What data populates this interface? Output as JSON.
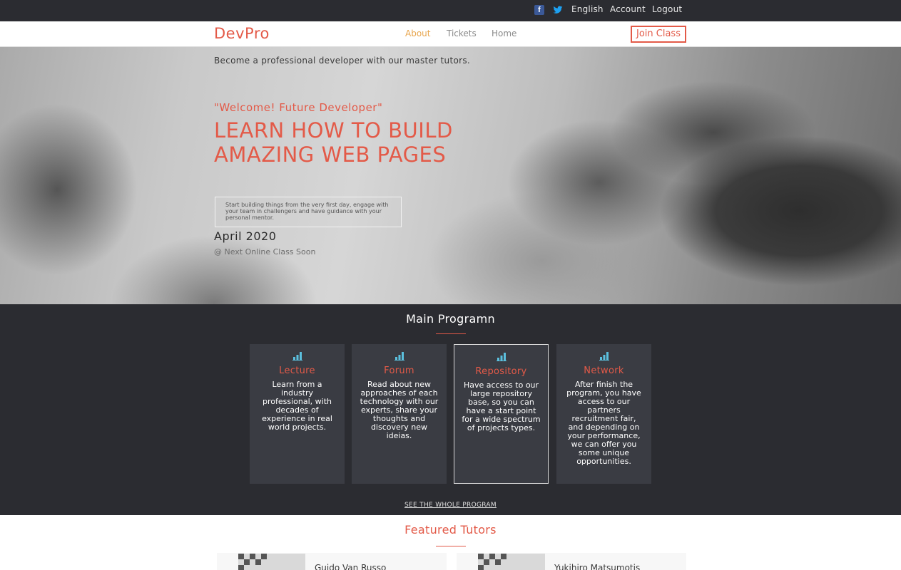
{
  "topbar": {
    "social": [
      {
        "icon": "facebook-icon",
        "color": "#3b5998"
      },
      {
        "icon": "twitter-icon",
        "color": "#1da1f2"
      }
    ],
    "language": "English",
    "account": "Account",
    "logout": "Logout"
  },
  "navbar": {
    "logo": "DevPro",
    "links": [
      "About",
      "Tickets",
      "Home"
    ],
    "active_link": "About",
    "join_button": "Join Class"
  },
  "hero": {
    "tagline": "Become a professional developer with our master tutors.",
    "welcome": "\"Welcome! Future Developer\"",
    "headline": "LEARN HOW TO BUILD AMAZING WEB PAGES",
    "description": "Start building things from the very first day, engage with your team in challengers and have guidance with your personal mentor.",
    "date": "April 2020",
    "next_class": "@ Next Online Class Soon"
  },
  "program": {
    "title": "Main Programn",
    "cards": [
      {
        "icon": "bar-chart-icon",
        "title": "Lecture",
        "text": "Learn from a industry professional, with decades of experience in real world projects."
      },
      {
        "icon": "bar-chart-icon",
        "title": "Forum",
        "text": "Read about new approaches of each technology with our experts, share your thoughts and discovery new ideias."
      },
      {
        "icon": "bar-chart-icon",
        "title": "Repository",
        "text": "Have access to our large repository base, so you can have a start point for a wide spectrum of projects types."
      },
      {
        "icon": "bar-chart-icon",
        "title": "Network",
        "text": "After finish the program, you have access to our partners recruitment fair, and depending on your performance, we can offer you some unique opportunities."
      }
    ],
    "see_all": "SEE THE WHOLE PROGRAM"
  },
  "tutors": {
    "title": "Featured Tutors",
    "list": [
      {
        "name": "Guido Van Russo"
      },
      {
        "name": "Yukihiro Matsumotis"
      }
    ]
  },
  "colors": {
    "accent": "#e35a48",
    "dark_bg": "#2b2c31",
    "card_bg": "#3a3c43",
    "icon": "#5bc0de"
  }
}
